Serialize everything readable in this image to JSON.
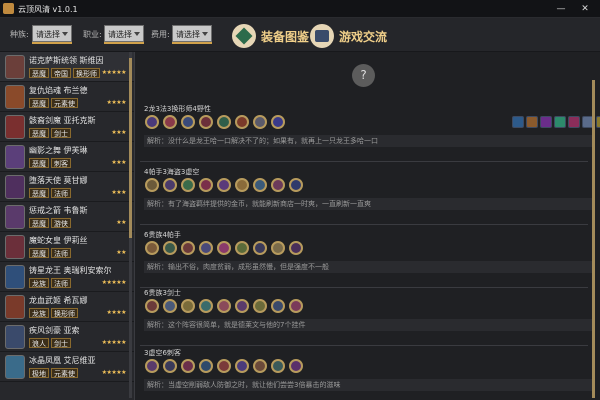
{
  "window": {
    "title": "云顶风清 v1.0.1",
    "minimize": "—",
    "close": "✕"
  },
  "filters": [
    {
      "label": "种族:",
      "value": "请选择"
    },
    {
      "label": "职业:",
      "value": "请选择"
    },
    {
      "label": "费用:",
      "value": "请选择"
    }
  ],
  "nav": {
    "equipment": "装备图鉴",
    "game": "游戏交流"
  },
  "heroes": [
    {
      "name": "诺克萨斯统领 斯维因",
      "tags": [
        "恶魔",
        "帝国",
        "换形师"
      ],
      "stars": "★★★★★",
      "color": "#6b3f3a"
    },
    {
      "name": "复仇焰魂 布兰德",
      "tags": [
        "恶魔",
        "元素使"
      ],
      "stars": "★★★★",
      "color": "#8a4a2a"
    },
    {
      "name": "骸裔剑魔 亚托克斯",
      "tags": [
        "恶魔",
        "剑士"
      ],
      "stars": "★★★",
      "color": "#7a2f2f"
    },
    {
      "name": "幽影之舞 伊芙琳",
      "tags": [
        "恶魔",
        "刺客"
      ],
      "stars": "★★★",
      "color": "#5b3f7a"
    },
    {
      "name": "堕落天使 莫甘娜",
      "tags": [
        "恶魔",
        "法师"
      ],
      "stars": "★★★",
      "color": "#4f2f5e"
    },
    {
      "name": "惩戒之箭 韦鲁斯",
      "tags": [
        "恶魔",
        "游侠"
      ],
      "stars": "★★",
      "color": "#5a3a6b"
    },
    {
      "name": "魔蛇女皇 伊莉丝",
      "tags": [
        "恶魔",
        "法师"
      ],
      "stars": "★★",
      "color": "#6b2f3a"
    },
    {
      "name": "铸星龙王 奥瑞利安索尔",
      "tags": [
        "龙族",
        "法师"
      ],
      "stars": "★★★★★",
      "color": "#2f4f7a"
    },
    {
      "name": "龙血武姬 希瓦娜",
      "tags": [
        "龙族",
        "换形师"
      ],
      "stars": "★★★★",
      "color": "#7a3a2a"
    },
    {
      "name": "疾风剑豪 亚索",
      "tags": [
        "浪人",
        "剑士"
      ],
      "stars": "★★★★★",
      "color": "#3a4a6b"
    },
    {
      "name": "冰晶凤凰 艾尼维亚",
      "tags": [
        "极地",
        "元素使"
      ],
      "stars": "★★★★★",
      "color": "#3a6b8a"
    }
  ],
  "help": "?",
  "items": [
    "#2d5a8a",
    "#8a5a2d",
    "#6b2d8a",
    "#2d8a6b",
    "#8a2d5a",
    "#5a6b8a",
    "#8a7a2d"
  ],
  "cards": [
    {
      "title": "2龙3法3换形师4野性",
      "champs": [
        "#4a3a7a",
        "#8a3a4a",
        "#3a4a7a",
        "#6b2f3a",
        "#2f5e4a",
        "#7a3a2a",
        "#5a5a6b",
        "#3a3a8a"
      ],
      "analysis": "解析：没什么是龙王哈一口解决不了的；如果有，就再上一只龙王多哈一口"
    },
    {
      "title": "4帕手3海盗3虚空",
      "champs": [
        "#6b5a3a",
        "#4a3a6b",
        "#3a6b4a",
        "#7a2f4a",
        "#5a3a7a",
        "#8a6b3a",
        "#3a5a7a",
        "#6b3a5a",
        "#2f3a6b"
      ],
      "analysis": "解析：有了海盗羁绊提供的金币，就能刷新商店一时爽，一直刷新一直爽"
    },
    {
      "title": "6贵族4帕手",
      "champs": [
        "#7a5a3a",
        "#3a5a4a",
        "#6b3a3a",
        "#4a4a7a",
        "#8a3a6b",
        "#5a6b3a",
        "#3a3a5a",
        "#7a6b4a",
        "#4a2f5a"
      ],
      "analysis": "解析：输出不俗，肉度贫弱，成形虽然慢，但是强度不一般"
    },
    {
      "title": "6贵族3剑士",
      "champs": [
        "#6b3a3a",
        "#4a5a7a",
        "#7a6b3a",
        "#3a6b6b",
        "#8a4a5a",
        "#5a3a6b",
        "#6b6b3a",
        "#3a4a6b",
        "#7a3a5a"
      ],
      "analysis": "解析：这个阵容很简单，就是德莱文与他的7个挂件"
    },
    {
      "title": "3虚空6刺客",
      "champs": [
        "#5a3a6b",
        "#3a3a5a",
        "#6b2f4a",
        "#2f4a6b",
        "#7a3a3a",
        "#4a3a7a",
        "#6b4a3a",
        "#3a5a5a",
        "#5a2f6b"
      ],
      "analysis": "解析：当虚空削弱敌人防御之时，就让他们尝尝3倍暴击的滋味"
    }
  ]
}
